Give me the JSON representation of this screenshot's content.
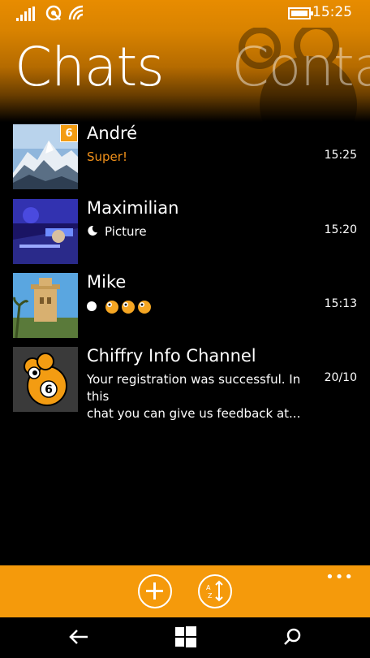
{
  "statusbar": {
    "time": "15:25"
  },
  "pivot": {
    "active": "Chats",
    "inactive": "Contac"
  },
  "chats": [
    {
      "name": "André",
      "preview": "Super!",
      "time": "15:25",
      "badge": "6"
    },
    {
      "name": "Maximilian",
      "preview": "Picture",
      "time": "15:20"
    },
    {
      "name": "Mike",
      "preview": "",
      "time": "15:13"
    },
    {
      "name": "Chiffry Info Channel",
      "preview_line1": "Your registration was successful. In this",
      "preview_line2": "chat you can give us feedback at...",
      "time": "20/10"
    }
  ],
  "colors": {
    "accent": "#f59a0b",
    "preview_orange": "#f0901a"
  },
  "appbar": {
    "more": "•••"
  }
}
